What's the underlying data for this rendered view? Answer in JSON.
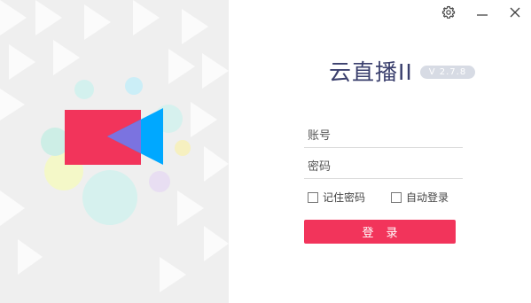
{
  "app": {
    "title": "云直播II",
    "version": "V 2.7.8"
  },
  "window_controls": {
    "settings_icon": "gear-icon",
    "minimize_icon": "minimize-icon",
    "close_icon": "close-icon"
  },
  "login_form": {
    "account_placeholder": "账号",
    "password_placeholder": "密码",
    "remember_password_label": "记住密码",
    "auto_login_label": "自动登录",
    "remember_password_checked": false,
    "auto_login_checked": false,
    "login_button_label": "登录"
  },
  "colors": {
    "accent": "#f2345b",
    "title": "#3a3f6d",
    "badge": "#d7dbe4",
    "logo_red": "#f2345b",
    "logo_blue": "#00a8ff",
    "logo_purple": "#7b73e0"
  },
  "illustration": {
    "logo_icon": "video-camera-icon"
  }
}
